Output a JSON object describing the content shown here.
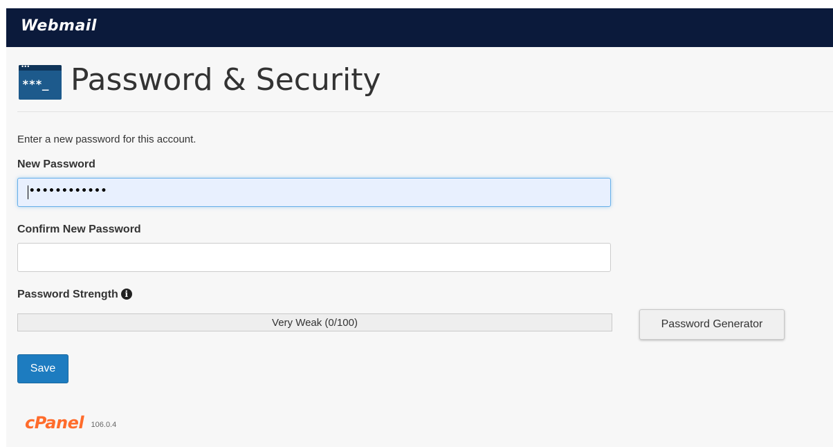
{
  "header": {
    "brand": "Webmail"
  },
  "page": {
    "icon_text": "***_",
    "title": "Password & Security",
    "intro": "Enter a new password for this account."
  },
  "form": {
    "new_password_label": "New Password",
    "new_password_value": "••••••••••••",
    "confirm_password_label": "Confirm New Password",
    "confirm_password_value": "",
    "strength_label": "Password Strength",
    "strength_text": "Very Weak (0/100)",
    "strength_score": 0,
    "generator_button": "Password Generator",
    "save_button": "Save"
  },
  "footer": {
    "logo": "cPanel",
    "version": "106.0.4"
  },
  "colors": {
    "topbar": "#0b1a3b",
    "primary": "#1d7cc0",
    "logo": "#ff6c2c"
  }
}
